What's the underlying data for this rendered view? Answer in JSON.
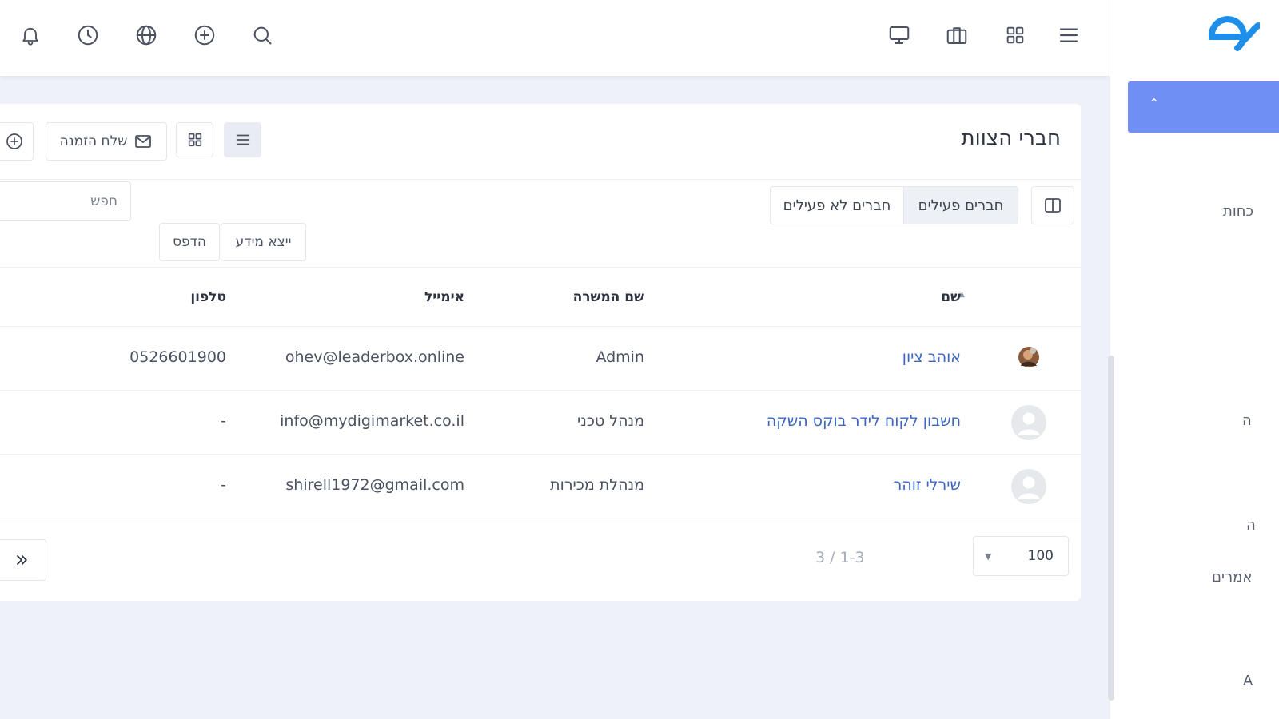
{
  "topbar": {
    "icons_left": [
      "bell-icon",
      "clock-icon",
      "globe-icon",
      "plus-circle-icon",
      "search-icon"
    ],
    "icons_right": [
      "monitor-icon",
      "briefcase-icon",
      "grid-icon",
      "menu-icon"
    ]
  },
  "sidebar": {
    "items": [
      "כחות",
      "ה",
      "ה",
      "אמרים",
      "A"
    ]
  },
  "card": {
    "title": "חברי הצוות",
    "invite_label": "שלח הזמנה",
    "search_placeholder": "חפש",
    "tabs": {
      "active": "חברים פעילים",
      "inactive": "חברים לא פעילים"
    },
    "export_label": "ייצא מידע",
    "print_label": "הדפס"
  },
  "table": {
    "columns": {
      "name": "שם",
      "role": "שם המשרה",
      "email": "אימייל",
      "phone": "טלפון"
    },
    "rows": [
      {
        "name": "אוהב ציון",
        "role": "Admin",
        "email": "ohev@leaderbox.online",
        "phone": "0526601900",
        "avatar": "photo"
      },
      {
        "name": "חשבון לקוח לידר בוקס השקה",
        "role": "מנהל טכני",
        "email": "info@mydigimarket.co.il",
        "phone": "-",
        "avatar": "default"
      },
      {
        "name": "שירלי זוהר",
        "role": "מנהלת מכירות",
        "email": "shirell1972@gmail.com",
        "phone": "-",
        "avatar": "default"
      }
    ]
  },
  "pagination": {
    "per_page": "100",
    "range": "3 / 1-3"
  },
  "colors": {
    "accent": "#6f8ff5",
    "link": "#3a66c4",
    "background": "#eef1f8"
  }
}
